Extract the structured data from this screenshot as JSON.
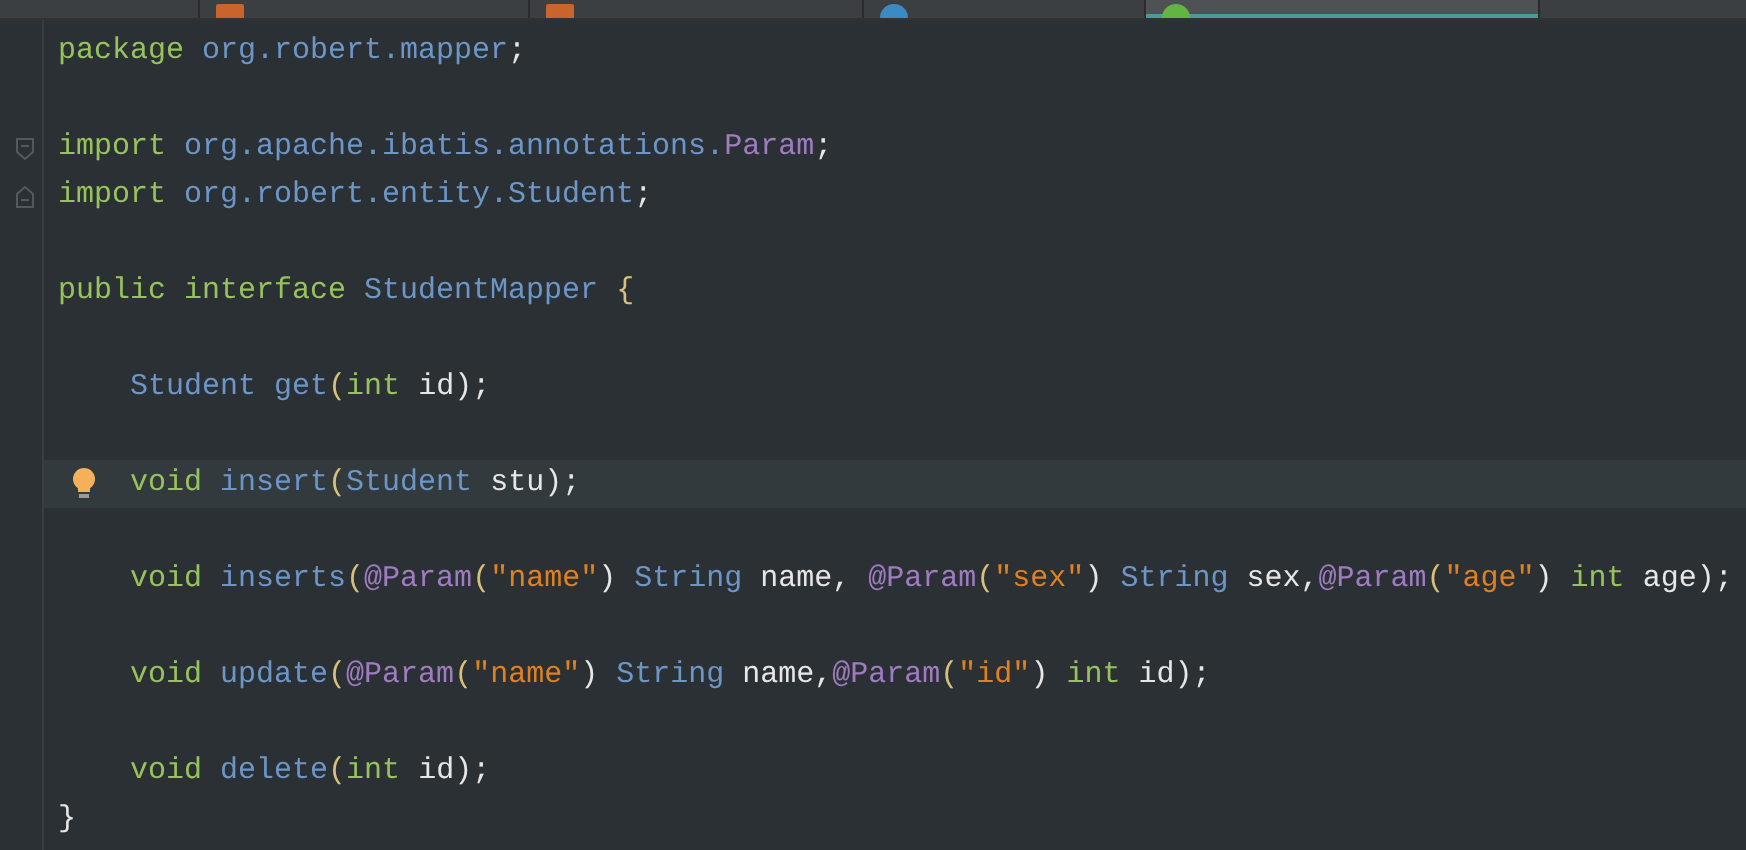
{
  "tabs": [
    {
      "kind": "plain",
      "selected": false
    },
    {
      "kind": "xml",
      "selected": false
    },
    {
      "kind": "xml",
      "selected": false
    },
    {
      "kind": "class",
      "selected": false
    },
    {
      "kind": "interface",
      "selected": true
    }
  ],
  "lines": [
    {
      "kind": "code",
      "tokens": [
        {
          "text": "package",
          "kind": "keyword"
        },
        {
          "text": " org.robert.mapper",
          "kind": "ident"
        },
        {
          "text": ";",
          "kind": "plain"
        }
      ]
    },
    {
      "kind": "blank"
    },
    {
      "kind": "fold-start",
      "tokens": [
        {
          "text": "import",
          "kind": "keyword"
        },
        {
          "text": " org.apache.ibatis.annotations.",
          "kind": "ident"
        },
        {
          "text": "Param",
          "kind": "annotation"
        },
        {
          "text": ";",
          "kind": "plain"
        }
      ]
    },
    {
      "kind": "fold-end",
      "tokens": [
        {
          "text": "import",
          "kind": "keyword"
        },
        {
          "text": " org.robert.entity.Student",
          "kind": "ident"
        },
        {
          "text": ";",
          "kind": "plain"
        }
      ]
    },
    {
      "kind": "blank"
    },
    {
      "kind": "code",
      "tokens": [
        {
          "text": "public interface",
          "kind": "keyword"
        },
        {
          "text": " StudentMapper ",
          "kind": "ident"
        },
        {
          "text": "{",
          "kind": "brace"
        }
      ]
    },
    {
      "kind": "blank"
    },
    {
      "kind": "code",
      "indented": true,
      "tokens": [
        {
          "text": "Student get",
          "kind": "ident"
        },
        {
          "text": "(",
          "kind": "brace"
        },
        {
          "text": "int",
          "kind": "keyword"
        },
        {
          "text": " id",
          "kind": "plain"
        },
        {
          "text": ");",
          "kind": "plain"
        }
      ]
    },
    {
      "kind": "blank"
    },
    {
      "kind": "code",
      "indented": true,
      "current": true,
      "tokens": [
        {
          "text": "void",
          "kind": "keyword"
        },
        {
          "text": " insert",
          "kind": "ident"
        },
        {
          "text": "(",
          "kind": "brace"
        },
        {
          "text": "Student",
          "kind": "ident"
        },
        {
          "text": " stu);",
          "kind": "plain"
        }
      ]
    },
    {
      "kind": "blank"
    },
    {
      "kind": "code",
      "indented": true,
      "tokens": [
        {
          "text": "void",
          "kind": "keyword"
        },
        {
          "text": " inserts",
          "kind": "ident"
        },
        {
          "text": "(",
          "kind": "brace"
        },
        {
          "text": "@Param",
          "kind": "annotation"
        },
        {
          "text": "(",
          "kind": "brace"
        },
        {
          "text": "\"name\"",
          "kind": "string"
        },
        {
          "text": ") ",
          "kind": "plain"
        },
        {
          "text": "String",
          "kind": "ident"
        },
        {
          "text": " name, ",
          "kind": "plain"
        },
        {
          "text": "@Param",
          "kind": "annotation"
        },
        {
          "text": "(",
          "kind": "brace"
        },
        {
          "text": "\"sex\"",
          "kind": "string"
        },
        {
          "text": ") ",
          "kind": "plain"
        },
        {
          "text": "String",
          "kind": "ident"
        },
        {
          "text": " sex,",
          "kind": "plain"
        },
        {
          "text": "@Param",
          "kind": "annotation"
        },
        {
          "text": "(",
          "kind": "brace"
        },
        {
          "text": "\"age\"",
          "kind": "string"
        },
        {
          "text": ") ",
          "kind": "plain"
        },
        {
          "text": "int",
          "kind": "keyword"
        },
        {
          "text": " age);",
          "kind": "plain"
        }
      ]
    },
    {
      "kind": "blank"
    },
    {
      "kind": "code",
      "indented": true,
      "tokens": [
        {
          "text": "void",
          "kind": "keyword"
        },
        {
          "text": " update",
          "kind": "ident"
        },
        {
          "text": "(",
          "kind": "brace"
        },
        {
          "text": "@Param",
          "kind": "annotation"
        },
        {
          "text": "(",
          "kind": "brace"
        },
        {
          "text": "\"name\"",
          "kind": "string"
        },
        {
          "text": ") ",
          "kind": "plain"
        },
        {
          "text": "String",
          "kind": "ident"
        },
        {
          "text": " name,",
          "kind": "plain"
        },
        {
          "text": "@Param",
          "kind": "annotation"
        },
        {
          "text": "(",
          "kind": "brace"
        },
        {
          "text": "\"id\"",
          "kind": "string"
        },
        {
          "text": ") ",
          "kind": "plain"
        },
        {
          "text": "int",
          "kind": "keyword"
        },
        {
          "text": " id);",
          "kind": "plain"
        }
      ]
    },
    {
      "kind": "blank"
    },
    {
      "kind": "code",
      "indented": true,
      "tokens": [
        {
          "text": "void",
          "kind": "keyword"
        },
        {
          "text": " delete",
          "kind": "ident"
        },
        {
          "text": "(",
          "kind": "brace"
        },
        {
          "text": "int",
          "kind": "keyword"
        },
        {
          "text": " id);",
          "kind": "plain"
        }
      ]
    },
    {
      "kind": "code",
      "tokens": [
        {
          "text": "}",
          "kind": "plain"
        }
      ]
    }
  ]
}
